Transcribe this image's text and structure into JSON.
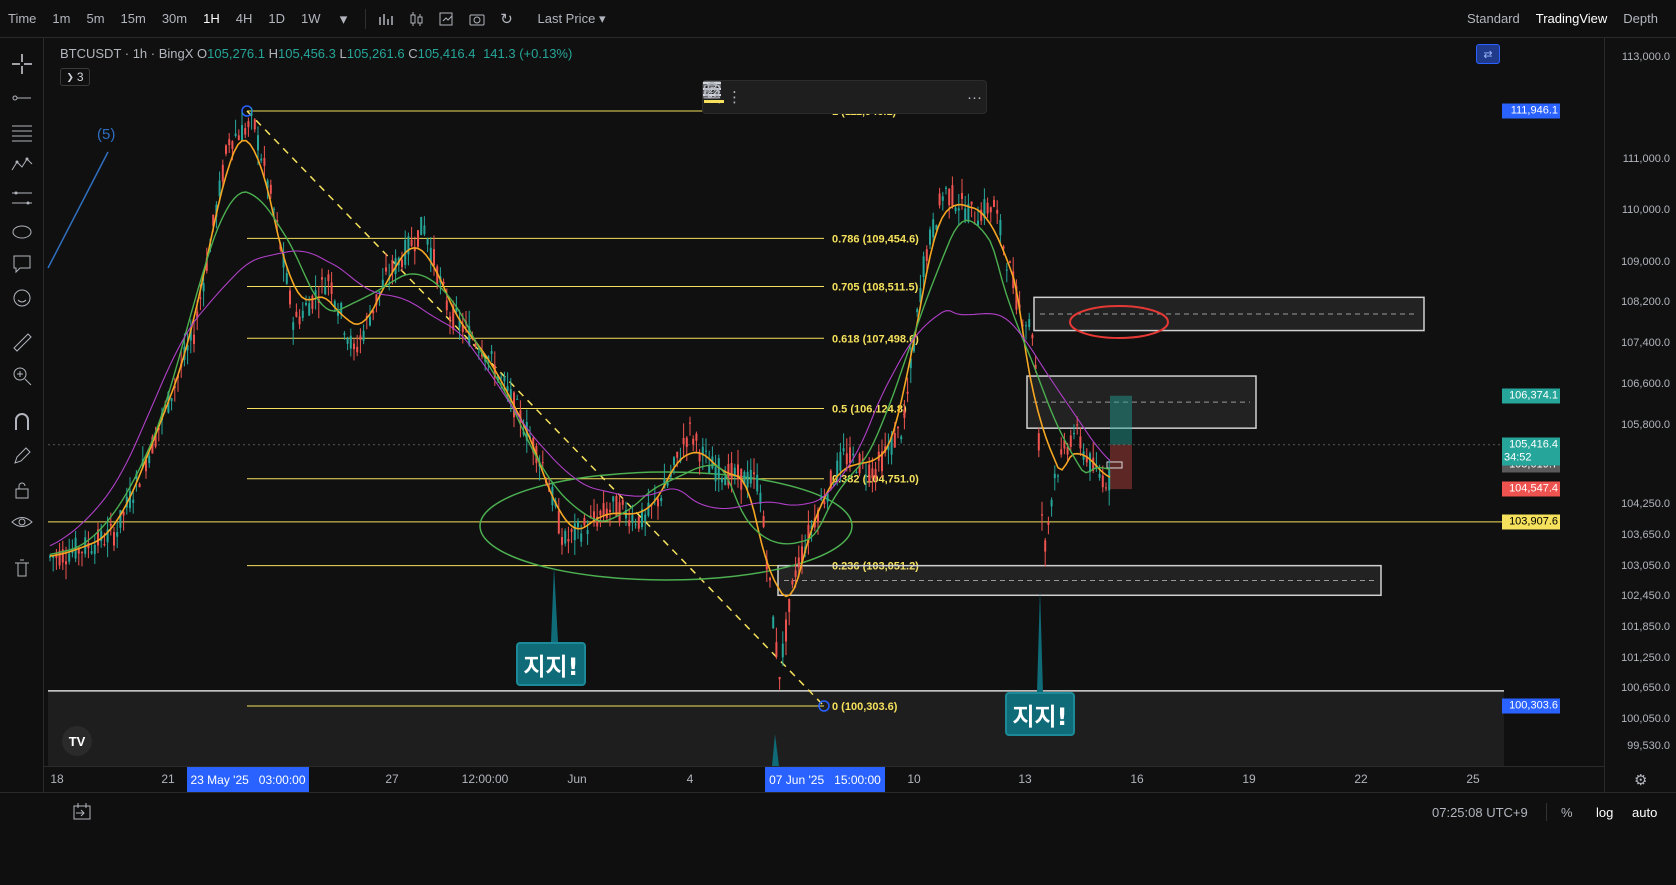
{
  "topbar": {
    "time_label": "Time",
    "intervals": [
      "1m",
      "5m",
      "15m",
      "30m",
      "1H",
      "4H",
      "1D",
      "1W"
    ],
    "active_interval": "1H",
    "price_source": "Last Price",
    "views": [
      "Standard",
      "TradingView",
      "Depth"
    ],
    "active_view": "TradingView"
  },
  "legend": {
    "symbol": "BTCUSDT · 1h · BingX",
    "open_label": "O",
    "open": "105,276.1",
    "high_label": "H",
    "high": "105,456.3",
    "low_label": "L",
    "low": "105,261.6",
    "close_label": "C",
    "close": "105,416.4",
    "change": "141.3 (+0.13%)",
    "indicator_count": "3"
  },
  "wave_label": "(5)",
  "price_scale": {
    "ticks": [
      "113,000.0",
      "111,000.0",
      "110,000.0",
      "109,000.0",
      "108,200.0",
      "107,400.0",
      "106,600.0",
      "105,800.0",
      "104,250.0",
      "103,650.0",
      "103,050.0",
      "102,450.0",
      "101,850.0",
      "101,250.0",
      "100,650.0",
      "100,050.0",
      "99,530.0"
    ],
    "labels": {
      "fib_high": "111,946.1",
      "green_level": "106,374.1",
      "current_price": "105,416.4",
      "countdown": "34:52",
      "gray_level": "105,019.7",
      "red_level": "104,547.4",
      "yellow_level": "103,907.6",
      "fib_low": "100,303.6"
    }
  },
  "fib_levels": [
    {
      "label": "1 (111,946.1)",
      "price": 111946.1
    },
    {
      "label": "0.786 (109,454.6)",
      "price": 109454.6
    },
    {
      "label": "0.705 (108,511.5)",
      "price": 108511.5
    },
    {
      "label": "0.618 (107,498.6)",
      "price": 107498.6
    },
    {
      "label": "0.5 (106,124.8)",
      "price": 106124.8
    },
    {
      "label": "0.382 (104,751.0)",
      "price": 104751.0
    },
    {
      "label": "0.236 (103,051.2)",
      "price": 103051.2
    },
    {
      "label": "0 (100,303.6)",
      "price": 100303.6
    }
  ],
  "annotations": {
    "support_1": "지지!",
    "support_2": "지지!"
  },
  "time_axis": {
    "labels": [
      "18",
      "21",
      "27",
      "12:00:00",
      "Jun",
      "4",
      "10",
      "13",
      "16",
      "19",
      "22",
      "25"
    ],
    "selected_start": {
      "date": "23 May '25",
      "time": "03:00:00"
    },
    "selected_end": {
      "date": "07 Jun '25",
      "time": "15:00:00"
    }
  },
  "bottombar": {
    "clock": "07:25:08 UTC+9",
    "percent": "%",
    "log": "log",
    "auto": "auto"
  },
  "colors": {
    "fib": "#f5e15c",
    "ema_fast": "#f5a623",
    "ema_mid": "#4caf50",
    "ema_slow": "#b040c8",
    "up": "#26a69a",
    "down": "#ef5350",
    "accent": "#2962ff"
  }
}
